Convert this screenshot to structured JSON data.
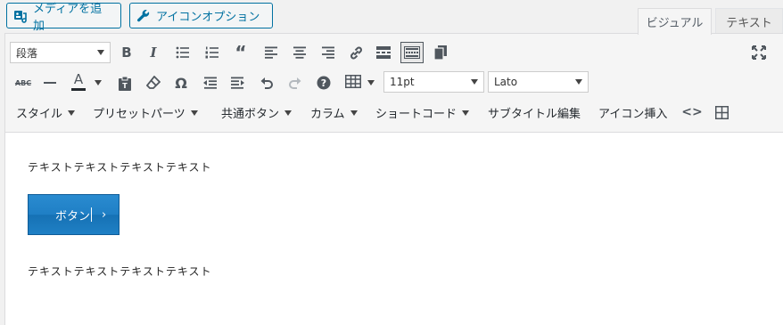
{
  "topbar": {
    "media_label": "メディアを追加",
    "iconopt_label": "アイコンオプション"
  },
  "tabs": {
    "visual": "ビジュアル",
    "text": "テキスト"
  },
  "toolbar": {
    "format_select": "段落",
    "fontsize_select": "11pt",
    "fontfamily_select": "Lato",
    "abc_label": "ABC",
    "text_color_label": "A"
  },
  "menus": [
    {
      "label": "スタイル"
    },
    {
      "label": "プリセットパーツ"
    },
    {
      "label": "共通ボタン"
    },
    {
      "label": "カラム"
    },
    {
      "label": "ショートコード"
    },
    {
      "label": "サブタイトル編集"
    },
    {
      "label": "アイコン挿入"
    }
  ],
  "content": {
    "para1": "テキストテキストテキストテキスト",
    "button_label": "ボタン",
    "button_chevron": "›",
    "para2": "テキストテキストテキストテキスト"
  },
  "colors": {
    "accent": "#0071a1",
    "button": "#1f80c5"
  }
}
